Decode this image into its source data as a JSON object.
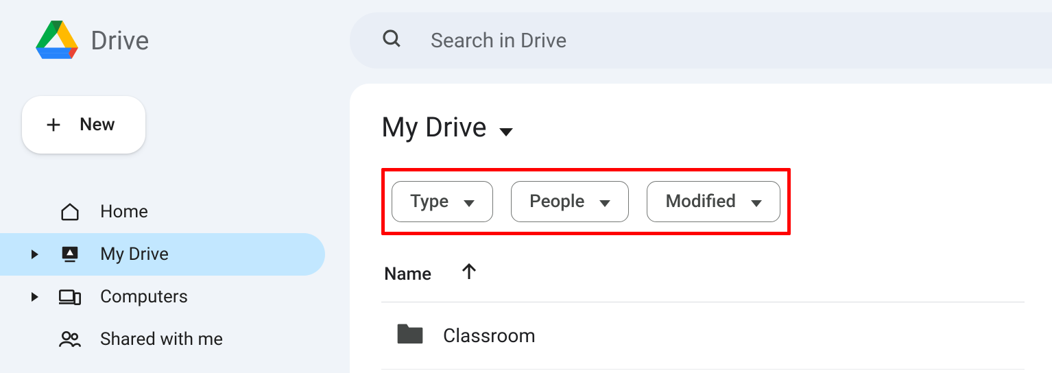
{
  "brand": {
    "name": "Drive"
  },
  "new_button": {
    "label": "New"
  },
  "sidebar": {
    "items": [
      {
        "label": "Home"
      },
      {
        "label": "My Drive"
      },
      {
        "label": "Computers"
      },
      {
        "label": "Shared with me"
      }
    ]
  },
  "search": {
    "placeholder": "Search in Drive"
  },
  "breadcrumb": {
    "title": "My Drive"
  },
  "filters": {
    "type": "Type",
    "people": "People",
    "modified": "Modified"
  },
  "table": {
    "column_name": "Name",
    "rows": [
      {
        "name": "Classroom"
      }
    ]
  }
}
